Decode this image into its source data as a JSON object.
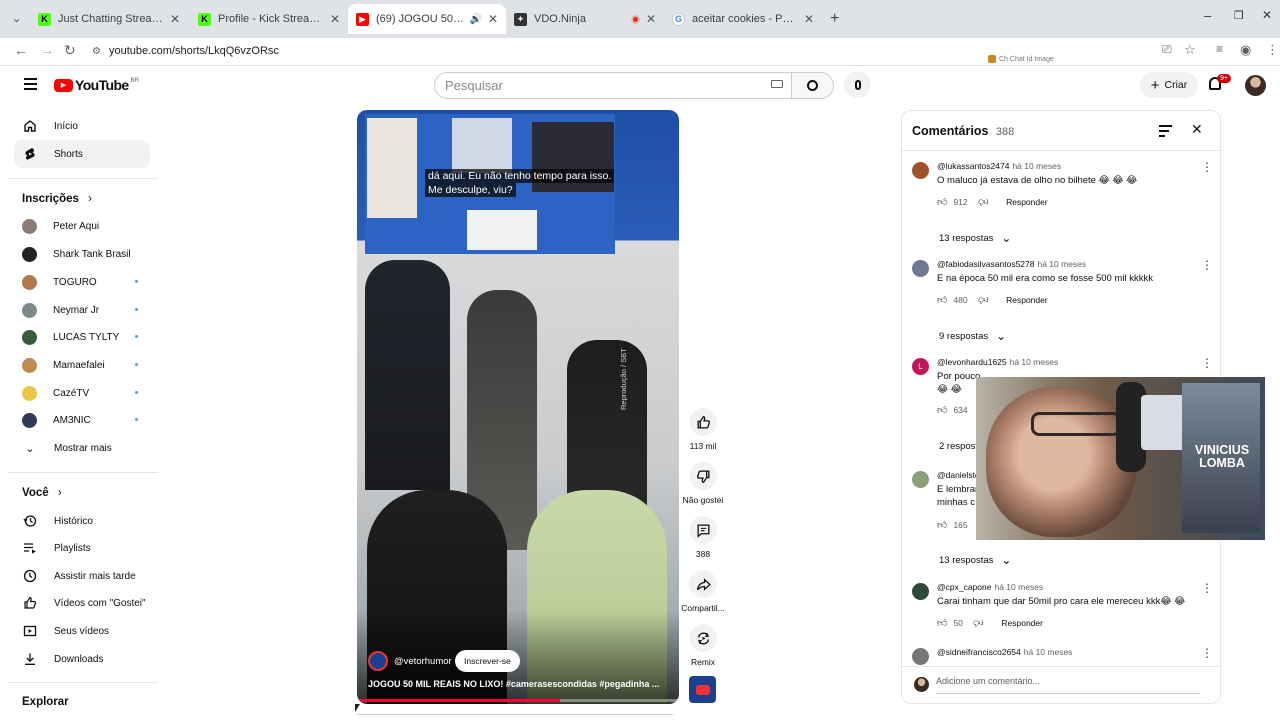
{
  "tabs": [
    {
      "title": "Just Chatting Streaming - Live",
      "favicon": "K",
      "color": "#53fc18"
    },
    {
      "title": "Profile - Kick Streaming",
      "favicon": "K",
      "color": "#53fc18"
    },
    {
      "title": "(69) JOGOU 50 MIL REAIS N",
      "favicon": "yt",
      "color": "#ff0000"
    },
    {
      "title": "VDO.Ninja",
      "favicon": "ninja",
      "color": "#333333"
    },
    {
      "title": "aceitar cookies - Pesquisa Goog",
      "favicon": "G",
      "color": "#4285f4"
    }
  ],
  "url": "youtube.com/shorts/LkqQ6vzORsc",
  "overlay_tag": "Ch Chat Id Image",
  "youtube": {
    "logo": "YouTube",
    "region": "BR",
    "search_placeholder": "Pesquisar",
    "create_label": "Criar",
    "notifications": "9+"
  },
  "sidebar": {
    "main": [
      {
        "label": "Início",
        "icon": "home-icon"
      },
      {
        "label": "Shorts",
        "icon": "shorts-icon"
      }
    ],
    "subscriptions_title": "Inscrições",
    "subscriptions": [
      {
        "label": "Peter Aqui",
        "new": false,
        "color": "#8c7b74"
      },
      {
        "label": "Shark Tank Brasil",
        "new": false,
        "color": "#222222"
      },
      {
        "label": "TOGURO",
        "new": true,
        "color": "#b07a4c"
      },
      {
        "label": "Neymar Jr",
        "new": true,
        "color": "#7d8a8c"
      },
      {
        "label": "LUCAS TYLTY",
        "new": true,
        "color": "#3b5c3a"
      },
      {
        "label": "Mamaefalei",
        "new": true,
        "color": "#c08a50"
      },
      {
        "label": "CazéTV",
        "new": true,
        "color": "#e8c64a"
      },
      {
        "label": "AM3NIC",
        "new": true,
        "color": "#2f3b52"
      }
    ],
    "show_more": "Mostrar mais",
    "you_title": "Você",
    "you": [
      {
        "label": "Histórico",
        "icon": "history-icon"
      },
      {
        "label": "Playlists",
        "icon": "playlists-icon"
      },
      {
        "label": "Assistir mais tarde",
        "icon": "watch-later-icon"
      },
      {
        "label": "Vídeos com \"Gostei\"",
        "icon": "like-icon"
      },
      {
        "label": "Seus vídeos",
        "icon": "your-videos-icon"
      },
      {
        "label": "Downloads",
        "icon": "download-icon"
      }
    ],
    "explore_title": "Explorar"
  },
  "video": {
    "caption_line1": "dá aqui. Eu não tenho tempo para isso.",
    "caption_line2": "Me desculpe, viu?",
    "watermark": "Reprodução / SBT",
    "channel": "@vetorhumor",
    "subscribe": "Inscrever-se",
    "title": "JOGOU 50 MIL REAIS NO LIXO! #camerasescondidas #pegadinha ...",
    "progress": 0.63
  },
  "actions": {
    "likes": "113 mil",
    "dislike": "Não gostei",
    "comments": "388",
    "share": "Compartil...",
    "remix": "Remix"
  },
  "comments_panel": {
    "title": "Comentários",
    "count": "388",
    "reply_label": "Responder",
    "add_placeholder": "Adicione um comentário...",
    "items": [
      {
        "user": "@lukassantos2474",
        "when": "há 10 meses",
        "text": "O maluco já estava de olho no bilhete 😂 😂 😂",
        "likes": "912",
        "replies": "13 respostas",
        "avatar": "#a0522d",
        "initial": ""
      },
      {
        "user": "@fabiodasilvasantos5278",
        "when": "há 10 meses",
        "text": "E na época 50 mil era como se fosse 500 mil kkkkk",
        "likes": "480",
        "replies": "9 respostas",
        "avatar": "#6b7a8f",
        "initial": ""
      },
      {
        "user": "@levonhardu1625",
        "when": "há 10 meses",
        "text": "Por pouco",
        "text2": "😂 😂",
        "likes": "634",
        "replies": "2 respostas",
        "avatar": "#c2185b",
        "initial": "L"
      },
      {
        "user": "@danielste",
        "when": "",
        "text": "E lembrar",
        "text2": "minhas c",
        "likes": "165",
        "replies": "13 respostas",
        "avatar": "#8aa07a",
        "initial": ""
      },
      {
        "user": "@cpx_capone",
        "when": "há 10 meses",
        "text": "Carai tinham que dar 50mil pro cara ele mereceu kkk😂 😂",
        "likes": "50",
        "replies": "",
        "avatar": "#2e4a3a",
        "initial": ""
      },
      {
        "user": "@sidneifrancisco2654",
        "when": "há 10 meses",
        "text": "",
        "likes": "",
        "replies": "",
        "avatar": "#777777",
        "initial": ""
      }
    ]
  },
  "webcam": {
    "name_line1": "VINICIUS",
    "name_line2": "LOMBA"
  }
}
